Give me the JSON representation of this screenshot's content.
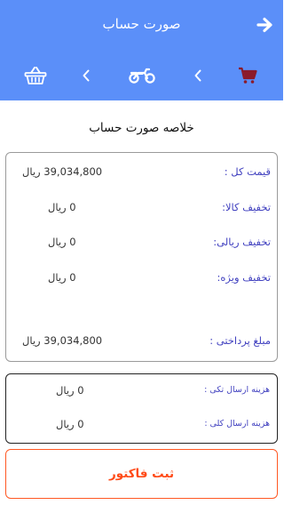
{
  "header": {
    "title": "صورت حساب",
    "color": "#5b8ff9",
    "back_icon": "arrow-right-icon",
    "steps": [
      {
        "icon": "cart-icon"
      },
      {
        "icon": "chevron-left-icon"
      },
      {
        "icon": "motorcycle-icon"
      },
      {
        "icon": "chevron-left-icon"
      },
      {
        "icon": "basket-icon"
      }
    ]
  },
  "summary": {
    "title": "خلاصه صورت حساب",
    "rows": [
      {
        "label": "قیمت کل :",
        "value": "39,034,800 ریال"
      },
      {
        "label": "تخفیف کالا:",
        "value": "0 ریال"
      },
      {
        "label": "تخفیف ریالی:",
        "value": "0 ریال"
      },
      {
        "label": "تخفیف ویژه:",
        "value": "0 ریال"
      },
      {
        "label": "مبلغ پرداختی :",
        "value": "39,034,800 ریال"
      }
    ]
  },
  "shipping": {
    "rows": [
      {
        "label": "هزینه ارسال تکی :",
        "value": "0 ریال"
      },
      {
        "label": "هزینه ارسال کلی :",
        "value": "0 ریال"
      }
    ]
  },
  "submit": {
    "label": "ثبت فاکتور",
    "color": "#ff5722"
  }
}
